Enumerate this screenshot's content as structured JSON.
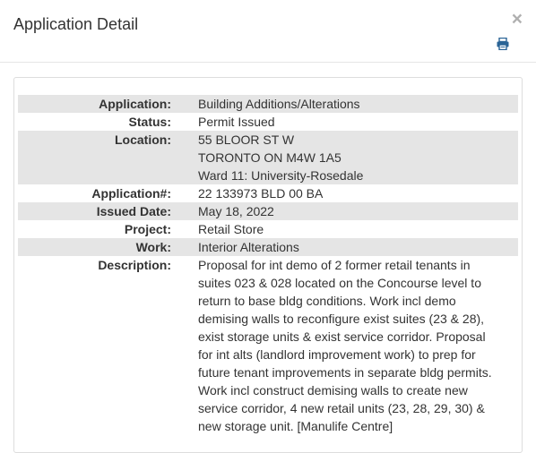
{
  "modal": {
    "title": "Application Detail",
    "close_label": "×",
    "print_icon": "print-icon"
  },
  "details": {
    "application_label": "Application:",
    "application_value": "Building Additions/Alterations",
    "status_label": "Status:",
    "status_value": "Permit Issued",
    "location_label": "Location:",
    "location_lines": [
      "55 BLOOR ST W",
      "TORONTO ON M4W 1A5",
      "Ward 11: University-Rosedale"
    ],
    "application_no_label": "Application#:",
    "application_no_value": "22 133973 BLD 00 BA",
    "issued_date_label": "Issued Date:",
    "issued_date_value": "May 18, 2022",
    "project_label": "Project:",
    "project_value": "Retail Store",
    "work_label": "Work:",
    "work_value": "Interior Alterations",
    "description_label": "Description:",
    "description_value": "Proposal for int demo of 2 former retail tenants in suites 023 & 028 located on the Concourse level to return to base bldg conditions. Work incl demo demising walls to reconfigure exist suites (23 & 28), exist storage units & exist service corridor. Proposal for int alts (landlord improvement work) to prep for future tenant improvements in separate bldg permits. Work incl construct demising walls to create new service corridor, 4 new retail units (23, 28, 29, 30) & new storage unit. [Manulife Centre]"
  },
  "colors": {
    "row_shade": "#e5e5e5",
    "print_icon": "#2a6496"
  }
}
